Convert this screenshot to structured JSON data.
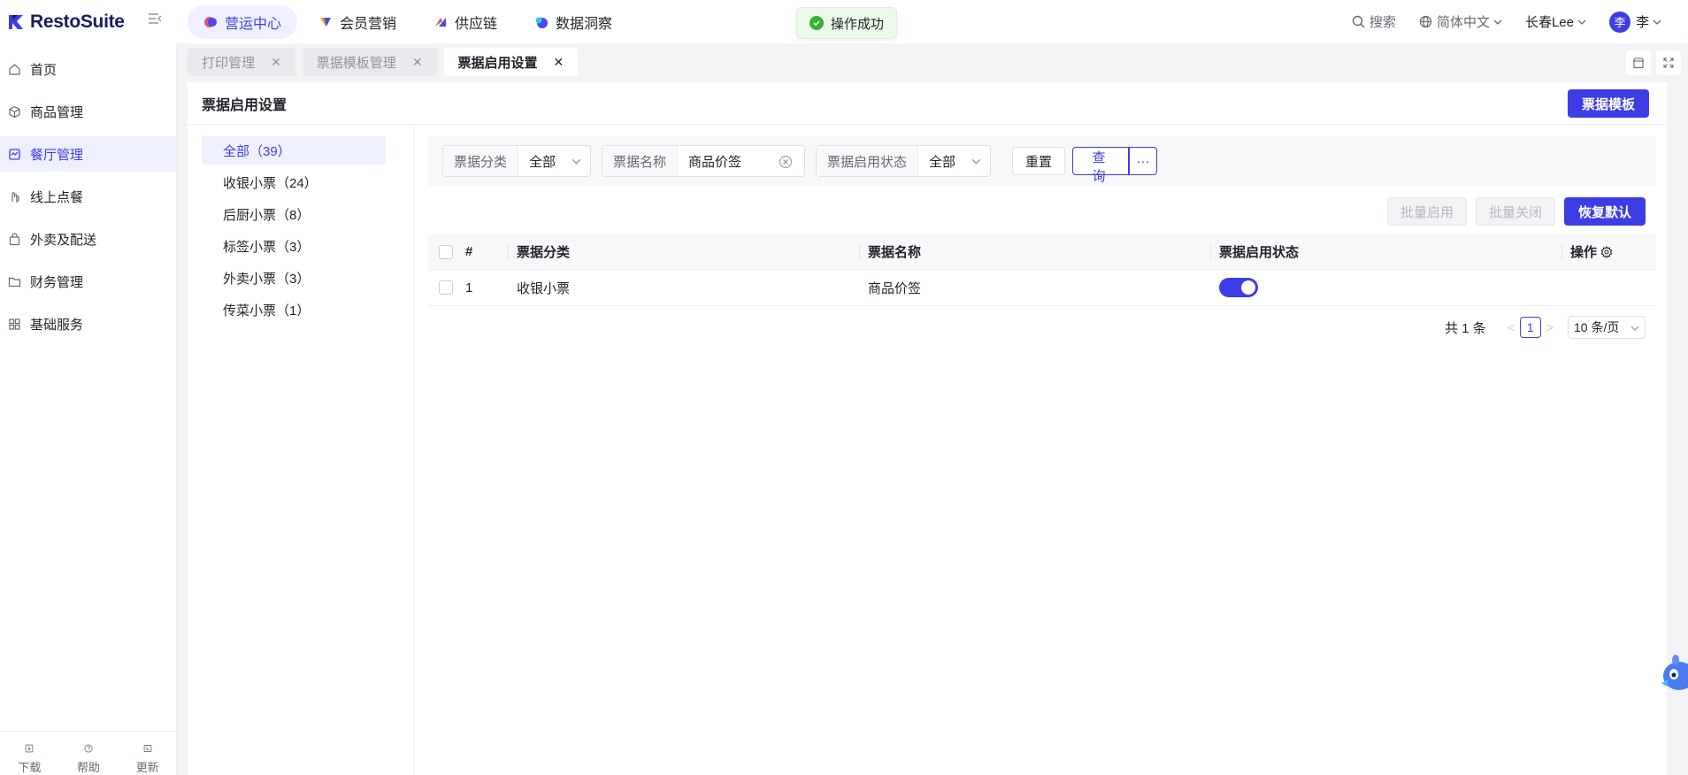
{
  "app": {
    "name": "RestoSuite"
  },
  "topnav": [
    {
      "label": "营运中心",
      "active": true
    },
    {
      "label": "会员营销",
      "active": false
    },
    {
      "label": "供应链",
      "active": false
    },
    {
      "label": "数据洞察",
      "active": false
    }
  ],
  "header_right": {
    "search": "搜索",
    "language": "简体中文",
    "store": "长春Lee",
    "avatar": "李",
    "user": "李"
  },
  "toast": {
    "message": "操作成功"
  },
  "sidebar": {
    "items": [
      {
        "label": "首页",
        "icon": "home-icon"
      },
      {
        "label": "商品管理",
        "icon": "box-icon"
      },
      {
        "label": "餐厅管理",
        "icon": "restaurant-icon",
        "active": true
      },
      {
        "label": "线上点餐",
        "icon": "hand-icon"
      },
      {
        "label": "外卖及配送",
        "icon": "bag-icon"
      },
      {
        "label": "财务管理",
        "icon": "folder-icon"
      },
      {
        "label": "基础服务",
        "icon": "grid-icon"
      }
    ],
    "bottom": [
      {
        "label": "下载",
        "icon": "download-icon"
      },
      {
        "label": "帮助",
        "icon": "help-icon"
      },
      {
        "label": "更新",
        "icon": "update-icon"
      }
    ]
  },
  "tabs": [
    {
      "label": "打印管理",
      "active": false
    },
    {
      "label": "票据模板管理",
      "active": false
    },
    {
      "label": "票据启用设置",
      "active": true
    }
  ],
  "page": {
    "title": "票据启用设置",
    "template_button": "票据模板"
  },
  "categories": [
    {
      "label": "全部（39）",
      "active": true
    },
    {
      "label": "收银小票（24）"
    },
    {
      "label": "后厨小票（8）"
    },
    {
      "label": "标签小票（3）"
    },
    {
      "label": "外卖小票（3）"
    },
    {
      "label": "传菜小票（1）"
    }
  ],
  "filters": {
    "category": {
      "label": "票据分类",
      "value": "全部"
    },
    "name": {
      "label": "票据名称",
      "value": "商品价签"
    },
    "state": {
      "label": "票据启用状态",
      "value": "全部"
    },
    "reset": "重置",
    "query": "查询",
    "more": "···"
  },
  "actions": {
    "batch_enable": "批量启用",
    "batch_disable": "批量关闭",
    "restore": "恢复默认"
  },
  "table": {
    "columns": [
      "#",
      "票据分类",
      "票据名称",
      "票据启用状态",
      "操作"
    ],
    "rows": [
      {
        "index": "1",
        "category": "收银小票",
        "name": "商品价签",
        "enabled": true
      }
    ]
  },
  "pagination": {
    "total": "共 1 条",
    "current": "1",
    "page_size": "10 条/页"
  },
  "colors": {
    "primary": "#3d3de8",
    "active_bg": "#eef0ff",
    "success": "#34b233"
  }
}
